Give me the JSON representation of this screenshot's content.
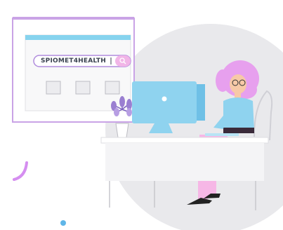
{
  "search": {
    "value": "SPIOMET4HEALTH"
  },
  "colors": {
    "background": "#ffffff",
    "circle": "#e9e9ec",
    "board_frame": "#c9a3e6",
    "board_topbar": "#86d3ee",
    "search_border": "#b08cdd",
    "search_button": "#f1b5e7",
    "monitor": "#8fd3ef",
    "hair": "#e7a0ee",
    "shirt": "#8fd3ef",
    "pants": "#f6b7e6",
    "desk": "#f4f4f6",
    "plant_leaves": "#9a7fd1",
    "accent_arc": "#d58ef0",
    "accent_dot": "#5fb6e8"
  },
  "icons": [
    "search-icon",
    "monitor-logo-icon"
  ]
}
